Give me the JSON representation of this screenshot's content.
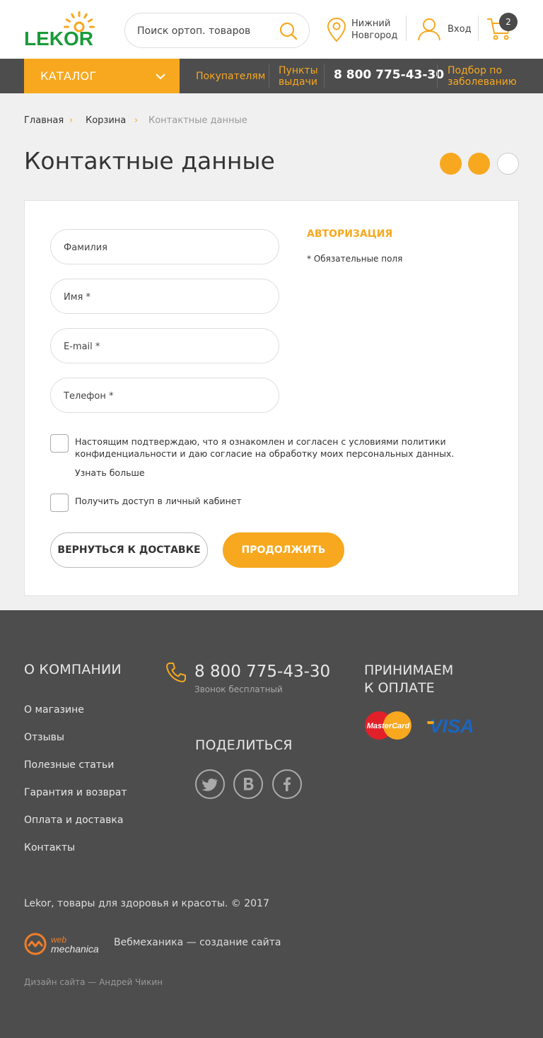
{
  "header": {
    "logo_text": "LEKOR",
    "search_placeholder": "Поиск ортоп. товаров",
    "city_line1": "Нижний",
    "city_line2": "Новгород",
    "login_label": "Вход",
    "cart_count": "2"
  },
  "nav": {
    "catalog_label": "КАТАЛОГ",
    "buyers_label": "Покупателям",
    "pickup_line1": "Пункты",
    "pickup_line2": "выдачи",
    "phone": "8 800 775-43-30",
    "selection_line1": "Подбор по",
    "selection_line2": "заболеванию"
  },
  "breadcrumb": {
    "items": [
      "Главная",
      "Корзина",
      "Контактные данные"
    ],
    "separator": "›"
  },
  "page": {
    "title": "Контактные данные",
    "steps_total": 3,
    "steps_completed": 2
  },
  "form": {
    "fields": [
      {
        "placeholder": "Фамилия",
        "value": ""
      },
      {
        "placeholder": "Имя *",
        "value": ""
      },
      {
        "placeholder": "E-mail *",
        "value": ""
      },
      {
        "placeholder": "Телефон *",
        "value": ""
      }
    ],
    "auth_label": "АВТОРИЗАЦИЯ",
    "required_note": "* Обязательные поля",
    "consent_text": "Настоящим подтверждаю, что я ознакомлен и согласен с условиями политики конфиденциальности и даю согласие на обработку моих персональных данных.",
    "learn_more": "Узнать больше",
    "cabinet_text": "Получить доступ в личный кабинет",
    "back_button": "ВЕРНУТЬСЯ К ДОСТАВКЕ",
    "next_button": "ПРОДОЛЖИТЬ"
  },
  "footer": {
    "about_heading": "О КОМПАНИИ",
    "links": [
      "О  магазине",
      "Отзывы",
      "Полезные статьи",
      "Гарантия и возврат",
      "Оплата и доставка",
      "Контакты"
    ],
    "phone": "8 800 775-43-30",
    "phone_note": "Звонок бесплатный",
    "share_heading": "ПОДЕЛИТЬСЯ",
    "pay_heading_line1": "ПРИНИМАЕМ",
    "pay_heading_line2": "К ОПЛАТЕ",
    "mastercard_label": "MasterCard",
    "visa_label": "VISA",
    "copyright": "Lekor, товары для здоровья и красоты. © 2017",
    "webmechanica_logo_line1": "web",
    "webmechanica_logo_line2": "mechanica",
    "webmechanica_text": "Вебмеханика — создание сайта",
    "design_credit": "Дизайн сайта — Андрей Чикин"
  },
  "colors": {
    "accent": "#f7a81f",
    "brand_green": "#1a9a3a",
    "dark": "#4d4d4d"
  }
}
